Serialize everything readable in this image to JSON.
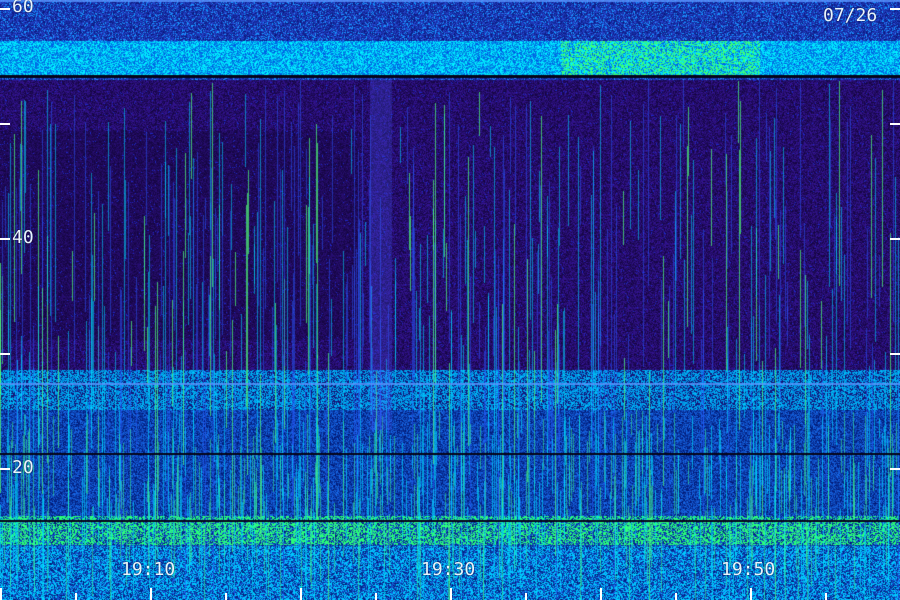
{
  "date_label": "07/26",
  "y_axis": {
    "labels": [
      "60",
      "40",
      "20"
    ]
  },
  "x_axis": {
    "labels": [
      "19:10",
      "19:30",
      "19:50"
    ]
  },
  "colors": {
    "background": "#1a0a4a",
    "band": "#0078ff",
    "band_highlight": "#00ffd0",
    "bright": "#40ff60",
    "text": "#e8f4ff"
  }
}
